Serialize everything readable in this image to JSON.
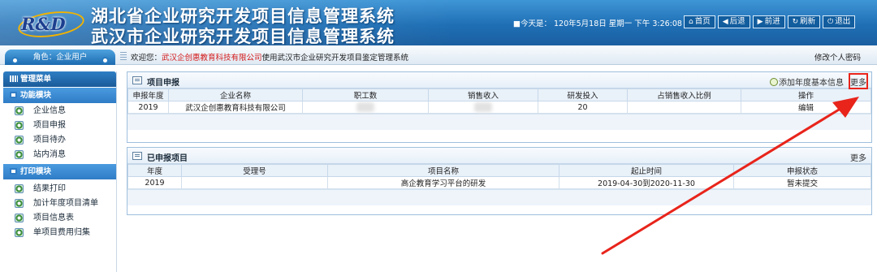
{
  "header": {
    "logo_text": "R&D",
    "title_line1": "湖北省企业研究开发项目信息管理系统",
    "title_line2": "武汉市企业研究开发项目信息管理系统",
    "today": "■今天是： 120年5月18日 星期一 下午 3:26:08",
    "buttons": [
      {
        "label": "首页",
        "icon": "home-icon"
      },
      {
        "label": "后退",
        "icon": "back-arrow-icon"
      },
      {
        "label": "前进",
        "icon": "forward-arrow-icon"
      },
      {
        "label": "刷新",
        "icon": "refresh-icon"
      },
      {
        "label": "退出",
        "icon": "power-icon"
      }
    ]
  },
  "welcome_bar": {
    "role": "角色：企业用户",
    "welcome_prefix": "欢迎您：",
    "company": "武汉企创惠教育科技有限公司",
    "welcome_suffix": "使用武汉市企业研究开发项目鉴定管理系统",
    "change_password": "修改个人密码"
  },
  "sidebar": {
    "menu_title": "管理菜单",
    "sections": [
      {
        "title": "功能模块",
        "items": [
          "企业信息",
          "项目申报",
          "项目待办",
          "站内消息"
        ]
      },
      {
        "title": "打印模块",
        "items": [
          "结果打印",
          "加计年度项目清单",
          "项目信息表",
          "单项目费用归集"
        ]
      }
    ]
  },
  "project_panel": {
    "title": "项目申报",
    "add_info": "添加年度基本信息",
    "more": "更多",
    "columns": [
      "申报年度",
      "企业名称",
      "职工数",
      "销售收入",
      "研发投入",
      "占销售收入比例",
      "操作"
    ],
    "rows": [
      {
        "year": "2019",
        "company": "武汉企创惠教育科技有限公司",
        "staff": "",
        "sales": "",
        "rd": "20",
        "ratio": "",
        "action": "编辑"
      }
    ]
  },
  "declared_panel": {
    "title": "已申报项目",
    "more": "更多",
    "columns": [
      "年度",
      "受理号",
      "项目名称",
      "起止时间",
      "申报状态"
    ],
    "rows": [
      {
        "year": "2019",
        "accept_no": "",
        "name": "高企教育学习平台的研发",
        "period": "2019-04-30到2020-11-30",
        "status": "暂未提交"
      }
    ]
  },
  "colors": {
    "header_blue": "#1f6fb5",
    "annotation_red": "#e8241b",
    "company_red": "#d41b1b"
  }
}
